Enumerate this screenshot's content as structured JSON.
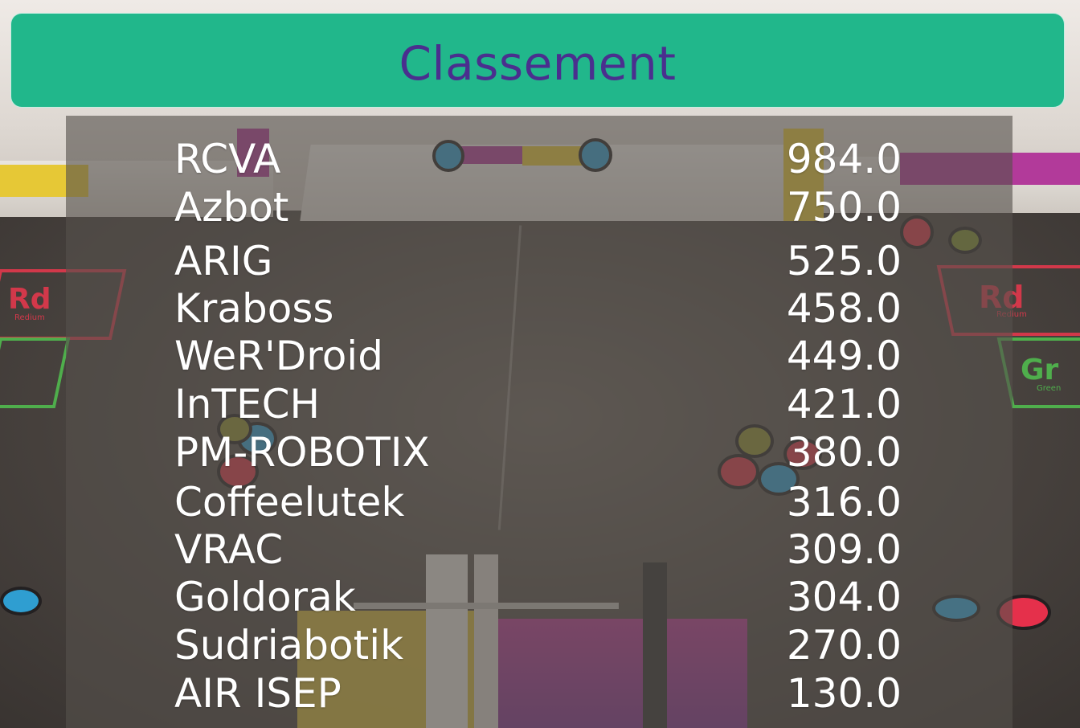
{
  "header": {
    "title": "Classement"
  },
  "standings": [
    {
      "team": "RCVA",
      "score": "984.0"
    },
    {
      "team": "Azbot",
      "score": "750.0"
    },
    {
      "team": "ARIG",
      "score": "525.0"
    },
    {
      "team": "Kraboss",
      "score": "458.0"
    },
    {
      "team": "WeR'Droid",
      "score": "449.0"
    },
    {
      "team": "InTECH",
      "score": "421.0"
    },
    {
      "team": "PM-ROBOTIX",
      "score": "380.0"
    },
    {
      "team": "Coffeelutek",
      "score": "316.0"
    },
    {
      "team": "VRAC",
      "score": "309.0"
    },
    {
      "team": "Goldorak",
      "score": "304.0"
    },
    {
      "team": "Sudriabotik",
      "score": "270.0"
    },
    {
      "team": "AIR ISEP",
      "score": "130.0"
    }
  ],
  "colors": {
    "header_bg": "#21b78b",
    "title_text": "#4a2f8e",
    "row_text": "#ffffff"
  },
  "background": {
    "zone_left": {
      "symbol": "Rd",
      "subtitle": "Redium"
    },
    "zone_right": {
      "symbol": "Rd",
      "subtitle": "Redium"
    },
    "zone_right_green": {
      "symbol": "Gr",
      "subtitle": "Green"
    }
  }
}
